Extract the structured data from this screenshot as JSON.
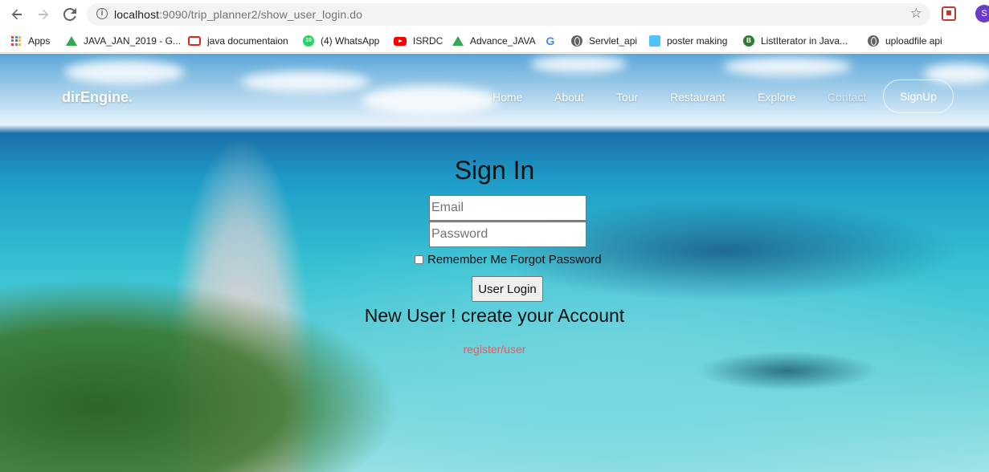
{
  "browser": {
    "url_host": "localhost",
    "url_path": ":9090/trip_planner2/show_user_login.do",
    "profile_initial": "S",
    "bookmarks": [
      {
        "label": "Apps",
        "icon": "apps-grid-icon"
      },
      {
        "label": "JAVA_JAN_2019 - G...",
        "icon": "drive-icon"
      },
      {
        "label": "java documentaion",
        "icon": "oracle-icon"
      },
      {
        "label": "(4) WhatsApp",
        "icon": "whatsapp-icon",
        "badge": "10"
      },
      {
        "label": "ISRDC",
        "icon": "youtube-icon"
      },
      {
        "label": "Advance_JAVA",
        "icon": "drive-icon"
      },
      {
        "label": "",
        "icon": "google-icon",
        "glyph": "G"
      },
      {
        "label": "Servlet_api",
        "icon": "globe-icon"
      },
      {
        "label": "poster making",
        "icon": "poster-icon"
      },
      {
        "label": "ListIterator in Java...",
        "icon": "listiterator-icon",
        "badge": "B"
      },
      {
        "label": "uploadfile api",
        "icon": "globe-icon"
      }
    ]
  },
  "navbar": {
    "brand": "dirEngine.",
    "items": [
      "Home",
      "About",
      "Tour",
      "Restaurant",
      "Explore",
      "Contact"
    ],
    "signup": "SignUp"
  },
  "login": {
    "title": "Sign In",
    "email_placeholder": "Email",
    "password_placeholder": "Password",
    "remember_label": "Remember Me",
    "forgot_label": "Forgot Password",
    "submit_label": "User Login",
    "new_user_text": "New User ! create your Account",
    "register_link": "register/user"
  },
  "colors": {
    "register_link": "#e8595b",
    "profile_avatar": "#6a3cc7"
  }
}
